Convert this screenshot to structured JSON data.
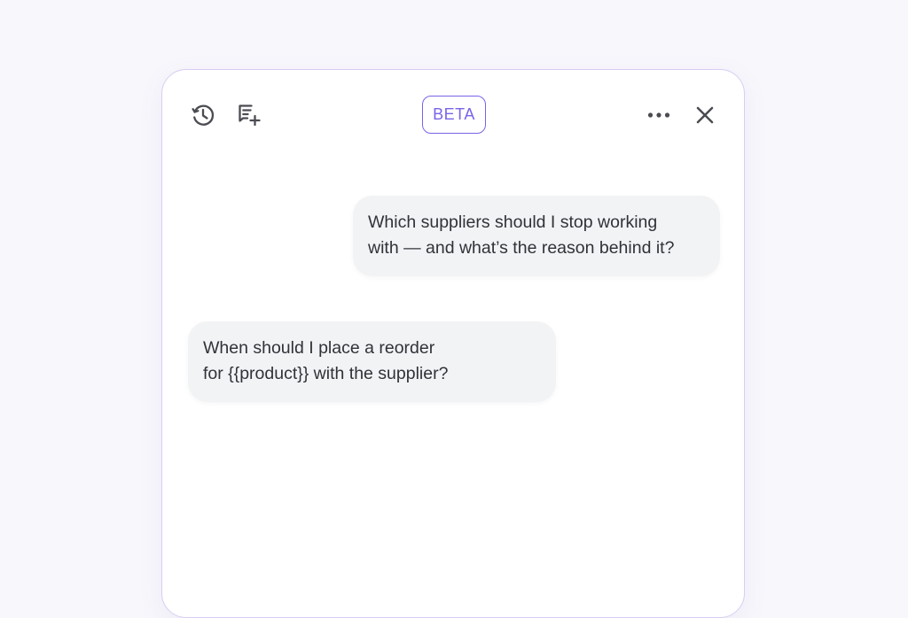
{
  "header": {
    "badge": "BETA",
    "icons": {
      "history": "history-icon",
      "new_chat": "new-chat-icon",
      "more": "more-horizontal-icon",
      "close": "close-icon"
    }
  },
  "messages": [
    {
      "side": "right",
      "lines": [
        "Which suppliers should I stop working",
        "with — and what’s the reason behind it?"
      ]
    },
    {
      "side": "left",
      "lines": [
        "When should I place a reorder",
        "for {{product}} with the supplier?"
      ]
    }
  ],
  "colors": {
    "accent": "#7a63e8",
    "panel_border": "#d9cdf4",
    "bubble_bg": "#f2f3f5",
    "text": "#303237",
    "icon": "#4a4c52"
  }
}
